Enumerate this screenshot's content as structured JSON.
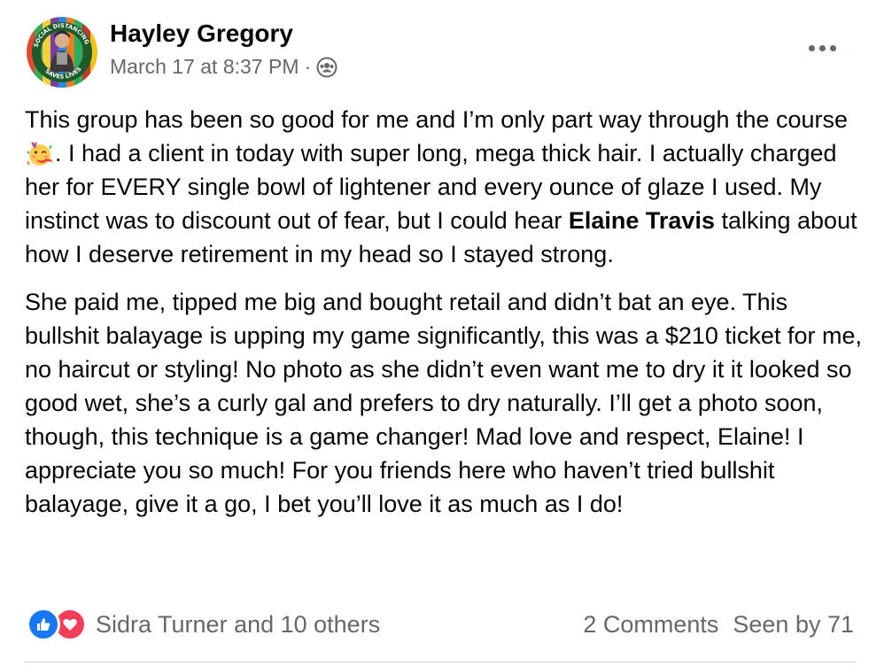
{
  "post": {
    "author": "Hayley Gregory",
    "timestamp": "March 17 at 8:37 PM",
    "meta_separator": "·",
    "audience_icon": "group-icon",
    "avatar_text": "SOCIAL DISTANCING SAVES LIVES",
    "paragraph1": {
      "part1": "This group has been so good for me and I’m only part way through the course",
      "emoji": "partying-face",
      "part2": ". I had a client in today with super long, mega thick hair. I actually charged her for EVERY single bowl of lightener and every ounce of glaze I used. My instinct was to discount out of fear, but I could hear ",
      "mention": "Elaine Travis",
      "part3": " talking about how I deserve retirement in my head so I stayed strong."
    },
    "paragraph2": "She paid me, tipped me big and bought retail and didn’t bat an eye. This bullshit balayage is upping my game significantly, this was a $210 ticket for me, no haircut or styling! No photo as she didn’t even want me to dry it it looked so good wet, she’s a curly gal and prefers to dry naturally. I’ll get a photo soon, though, this technique is a game changer! Mad love and respect, Elaine! I appreciate you so much! For you friends here who haven’t tried bullshit balayage, give it a go, I bet you’ll love it as much as I do!",
    "reactions": {
      "icons": [
        "like-icon",
        "love-icon"
      ],
      "summary": "Sidra Turner and 10 others"
    },
    "comments": "2 Comments",
    "seen_by": "Seen by 71",
    "colors": {
      "like": "#1877f2",
      "love": "#f33e58",
      "secondary_text": "#65676b",
      "primary_text": "#050505"
    }
  }
}
